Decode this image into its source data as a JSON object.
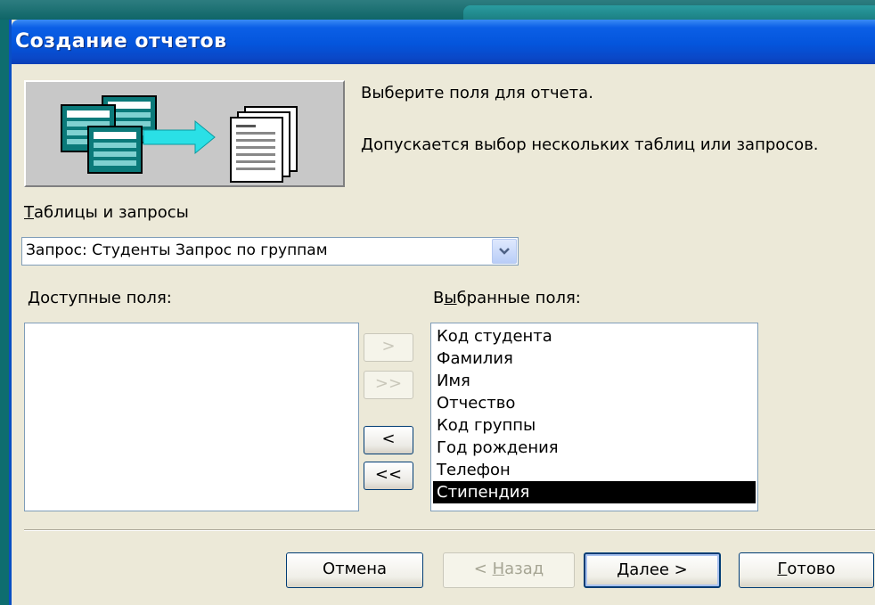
{
  "window": {
    "title": "Создание отчетов"
  },
  "messages": {
    "line1": "Выберите поля для отчета.",
    "line2": "Допускается выбор нескольких таблиц или запросов."
  },
  "tables": {
    "label_prefix": "",
    "label_hotkey": "Т",
    "label_rest": "аблицы и запросы",
    "selected_value": "Запрос: Студенты Запрос по группам"
  },
  "available_fields": {
    "label_prefix": "",
    "label_hotkey": "Д",
    "label_rest": "оступные поля:",
    "items": []
  },
  "selected_fields": {
    "label_prefix": "В",
    "label_hotkey": "ы",
    "label_rest": "бранные поля:",
    "items": [
      "Код студента",
      "Фамилия",
      "Имя",
      "Отчество",
      "Код группы",
      "Год рождения",
      "Телефон",
      "Стипендия"
    ],
    "selected_item": "Стипендия"
  },
  "move_buttons": {
    "add_one": ">",
    "add_all": ">>",
    "remove_one": "<",
    "remove_all": "<<"
  },
  "footer": {
    "cancel": "Отмена",
    "back_prefix": "< ",
    "back_hotkey": "Н",
    "back_rest": "азад",
    "next_hotkey": "Д",
    "next_rest": "алее >",
    "finish_hotkey": "Г",
    "finish_rest": "отово"
  },
  "colors": {
    "slide_background": "#0e6d6f",
    "titlebar": "#0455dc",
    "dialog_face": "#ece9d8",
    "selection": "#000000"
  }
}
